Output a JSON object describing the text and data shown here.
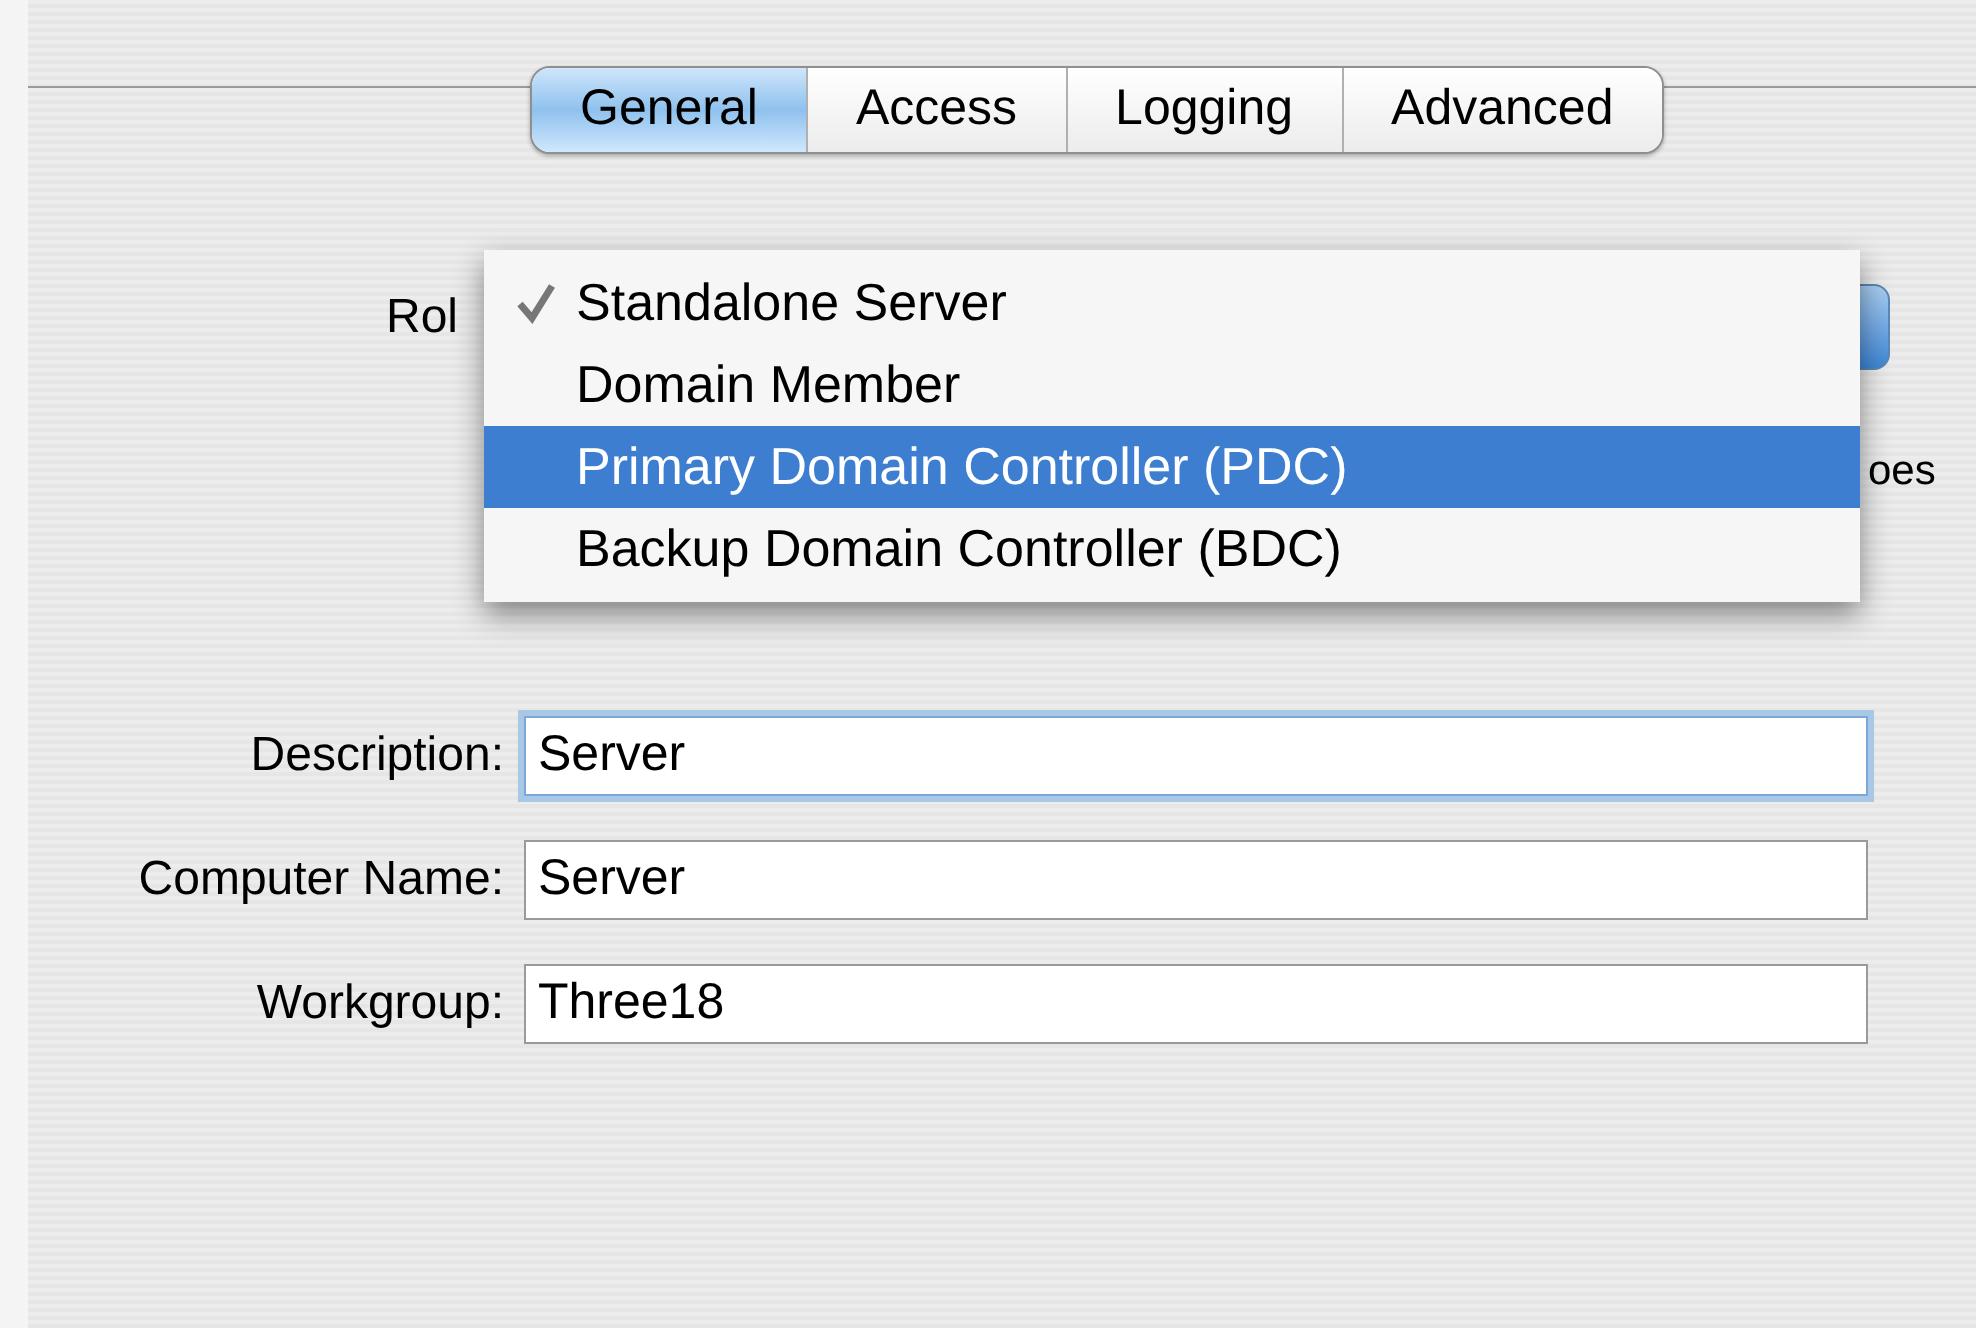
{
  "tabs": [
    {
      "label": "General",
      "selected": true
    },
    {
      "label": "Access",
      "selected": false
    },
    {
      "label": "Logging",
      "selected": false
    },
    {
      "label": "Advanced",
      "selected": false
    }
  ],
  "role": {
    "label": "Rol",
    "description_fragment": "oes"
  },
  "role_menu": [
    {
      "label": "Standalone Server",
      "checked": true,
      "selected": false
    },
    {
      "label": "Domain Member",
      "checked": false,
      "selected": false
    },
    {
      "label": "Primary Domain Controller (PDC)",
      "checked": false,
      "selected": true
    },
    {
      "label": "Backup Domain Controller (BDC)",
      "checked": false,
      "selected": false
    }
  ],
  "fields": [
    {
      "label": "Description:",
      "value": "Server",
      "focused": true
    },
    {
      "label": "Computer Name:",
      "value": "Server",
      "focused": false
    },
    {
      "label": "Workgroup:",
      "value": "Three18",
      "focused": false
    }
  ]
}
